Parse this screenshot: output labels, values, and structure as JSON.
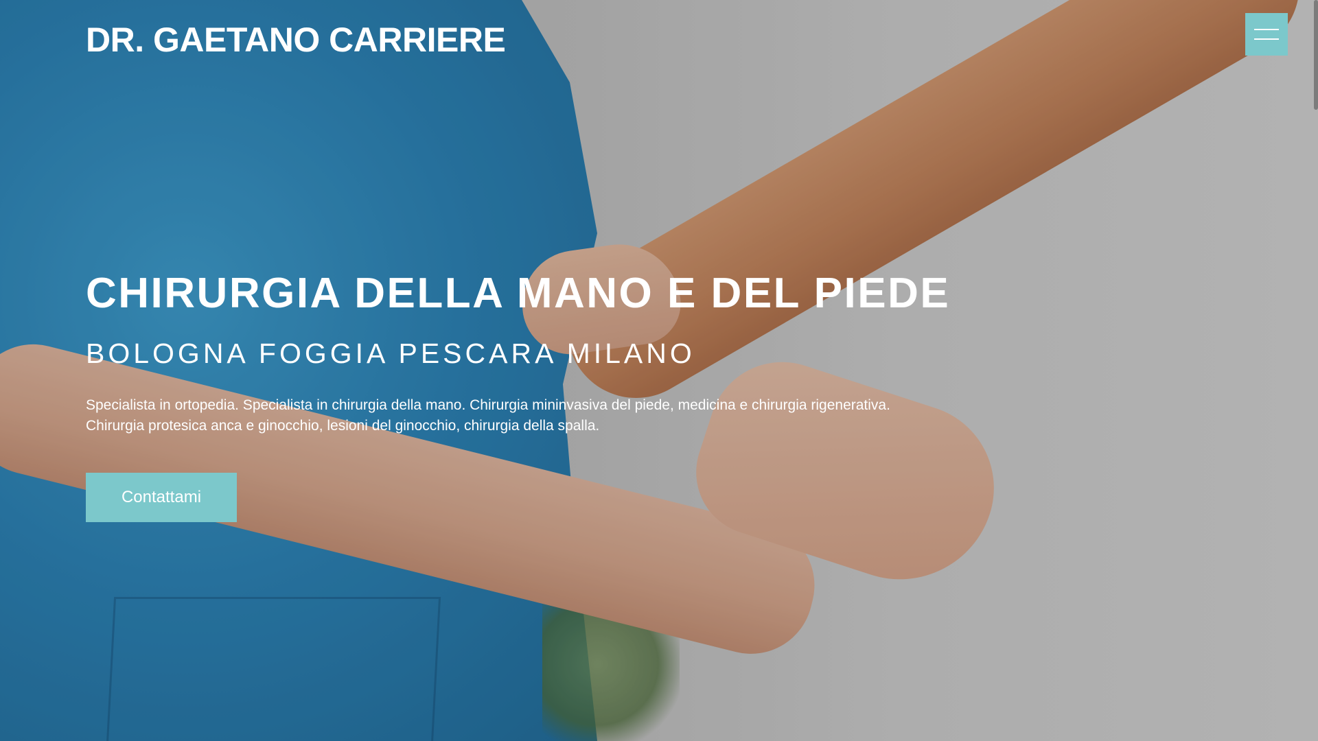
{
  "header": {
    "brand": "DR. GAETANO CARRIERE",
    "menu_icon": "hamburger-menu-icon"
  },
  "hero": {
    "headline": "CHIRURGIA DELLA MANO E DEL PIEDE",
    "cities": "BOLOGNA FOGGIA PESCARA MILANO",
    "description_line_1": "Specialista in ortopedia. Specialista in chirurgia della mano. Chirurgia mininvasiva del piede, medicina e chirurgia rigenerativa.",
    "description_line_2": "Chirurgia protesica anca e ginocchio, lesioni del ginocchio, chirurgia della spalla.",
    "cta_label": "Contattami"
  },
  "colors": {
    "accent": "#7cc8cb",
    "text": "#ffffff"
  }
}
